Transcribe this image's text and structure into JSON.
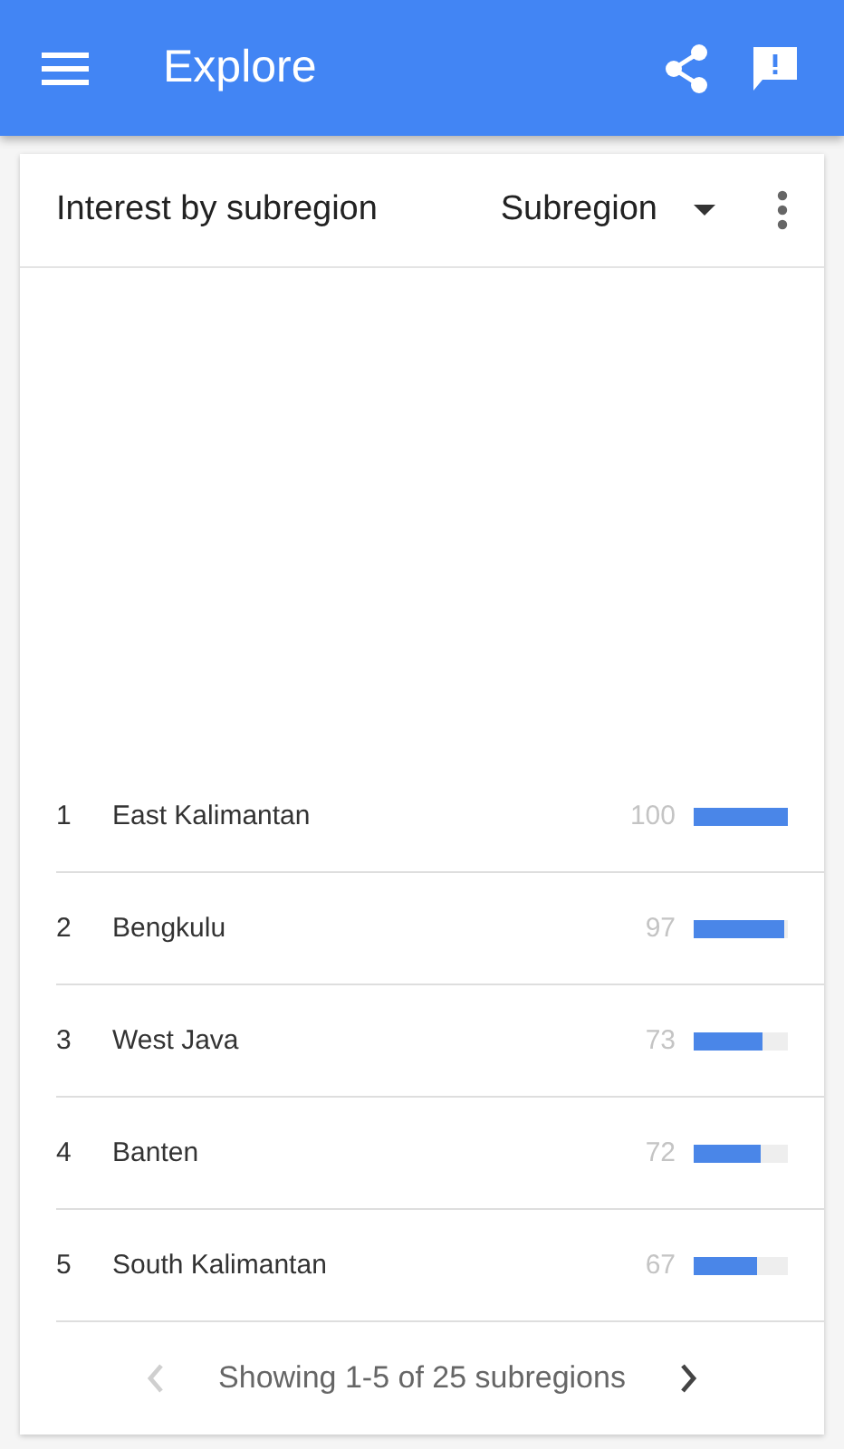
{
  "app_bar": {
    "title": "Explore"
  },
  "card": {
    "title": "Interest by subregion",
    "dropdown": {
      "value": "Subregion"
    },
    "rows": [
      {
        "rank": "1",
        "name": "East Kalimantan",
        "value": "100",
        "level": 1.0
      },
      {
        "rank": "2",
        "name": "Bengkulu",
        "value": "97",
        "level": 0.97
      },
      {
        "rank": "3",
        "name": "West Java",
        "value": "73",
        "level": 0.73
      },
      {
        "rank": "4",
        "name": "Banten",
        "value": "72",
        "level": 0.72
      },
      {
        "rank": "5",
        "name": "South Kalimantan",
        "value": "67",
        "level": 0.67
      }
    ],
    "pagination": {
      "text": "Showing 1-5 of 25 subregions",
      "prev_disabled": true,
      "next_disabled": false
    }
  }
}
